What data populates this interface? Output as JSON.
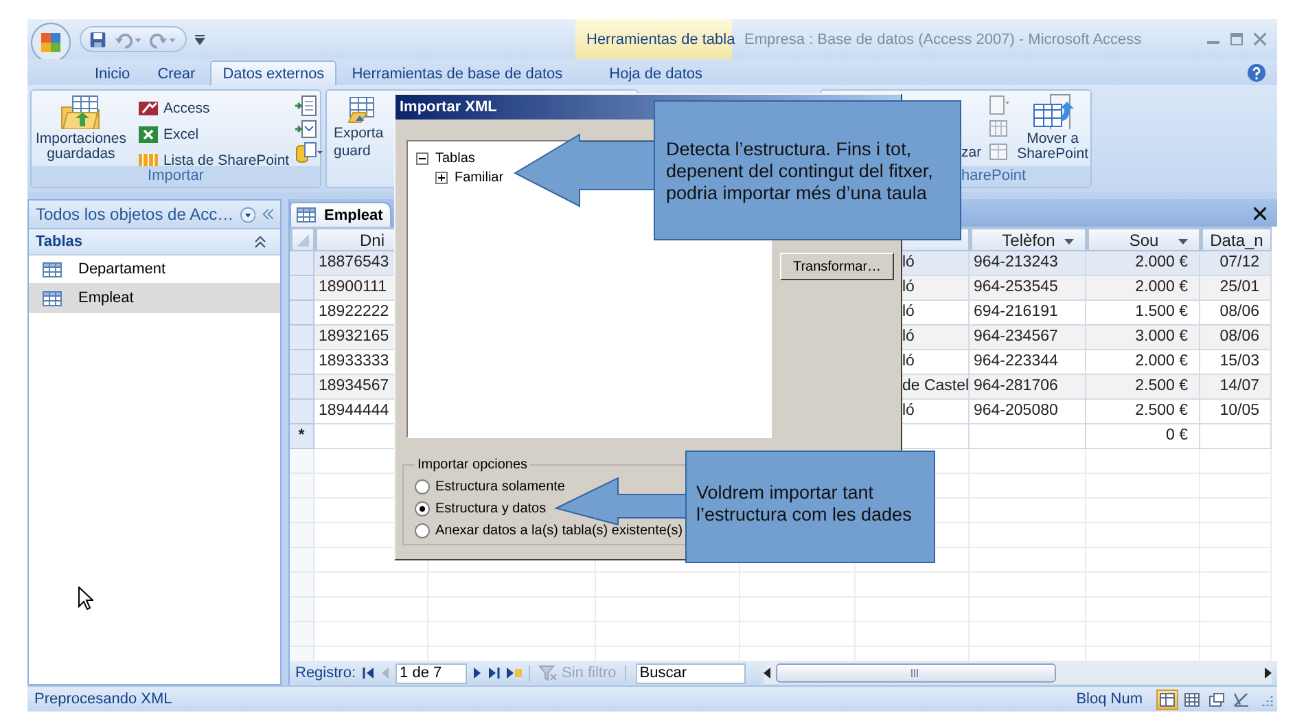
{
  "window": {
    "title": "Empresa : Base de datos (Access 2007) - Microsoft Access",
    "context_label": "Herramientas de tabla"
  },
  "ribbon_tabs": [
    {
      "label": "Inicio",
      "selected": false,
      "kind": "standard"
    },
    {
      "label": "Crear",
      "selected": false,
      "kind": "standard"
    },
    {
      "label": "Datos externos",
      "selected": true,
      "kind": "standard"
    },
    {
      "label": "Herramientas de base de datos",
      "selected": false,
      "kind": "standard"
    },
    {
      "label": "Hoja de datos",
      "selected": false,
      "kind": "contextual"
    }
  ],
  "ribbon": {
    "import_group": {
      "label": "Importar",
      "large_button": "Importaciones guardadas",
      "small_buttons": [
        "Access",
        "Excel",
        "Lista de SharePoint"
      ]
    },
    "export_group": {
      "button_lines": [
        "Exporta",
        "guard"
      ]
    },
    "sharepoint_group": {
      "label": "harePoint",
      "partial_button": "zar",
      "large_button": "Mover a SharePoint"
    }
  },
  "navigation_pane": {
    "title": "Todos los objetos de Acc…",
    "group": "Tablas",
    "items": [
      {
        "label": "Departament",
        "selected": false
      },
      {
        "label": "Empleat",
        "selected": true
      }
    ]
  },
  "document_tab": {
    "label": "Empleat"
  },
  "table": {
    "columns": [
      {
        "label": "Dni"
      },
      {
        "dropdown": false
      },
      {
        "label": "Telèfon",
        "dropdown": true
      },
      {
        "label": "Sou",
        "dropdown": true
      },
      {
        "label": "Data_n",
        "dropdown": false
      }
    ],
    "rows": [
      {
        "cells": [
          "18876543",
          "ló",
          "964-213243",
          "2.000 €",
          "07/12"
        ],
        "selected": true
      },
      {
        "cells": [
          "18900111",
          "ló",
          "964-253545",
          "2.000 €",
          "25/01"
        ],
        "selected": false
      },
      {
        "cells": [
          "18922222",
          "ló",
          "694-216191",
          "1.500 €",
          "08/06"
        ],
        "selected": false
      },
      {
        "cells": [
          "18932165",
          "ló",
          "964-234567",
          "3.000 €",
          "08/06"
        ],
        "selected": false
      },
      {
        "cells": [
          "18933333",
          "ló",
          "964-223344",
          "2.000 €",
          "15/03"
        ],
        "selected": false
      },
      {
        "cells": [
          "18934567",
          "de Castel",
          "964-281706",
          "2.500 €",
          "14/07"
        ],
        "selected": false
      },
      {
        "cells": [
          "18944444",
          "ló",
          "964-205080",
          "2.500 €",
          "10/05"
        ],
        "selected": false
      }
    ],
    "new_row": {
      "marker": "*",
      "sou": "0 €"
    }
  },
  "record_nav": {
    "label": "Registro:",
    "previous_disabled": true,
    "position": "1 de 7",
    "filter": {
      "label": "Sin filtro",
      "disabled": true
    },
    "search_placeholder": "Buscar"
  },
  "status_bar": {
    "text": "Preprocesando XML",
    "num_lock": "Bloq Num",
    "views": [
      {
        "selected": true
      },
      {
        "selected": false
      },
      {
        "selected": false
      },
      {
        "selected": false
      }
    ]
  },
  "dialog": {
    "title": "Importar XML",
    "tree": [
      {
        "label": "Tablas",
        "expanded": true,
        "children": [
          {
            "label": "Familiar",
            "expanded": false
          }
        ]
      }
    ],
    "button": "Transformar…",
    "options_label": "Importar opciones",
    "options": [
      {
        "label": "Estructura solamente",
        "selected": false
      },
      {
        "label": "Estructura y datos",
        "selected": true
      },
      {
        "label": "Anexar datos a la(s) tabla(s) existente(s)",
        "selected": false
      }
    ]
  },
  "callouts": [
    {
      "text": "Detecta l’estructura. Fins i tot, depenent del contingut del fitxer, podria importar més d’una taula"
    },
    {
      "text": "Voldrem importar tant l’estructura com les dades"
    }
  ]
}
